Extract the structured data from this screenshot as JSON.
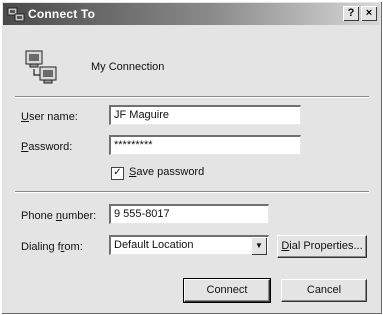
{
  "window": {
    "title": "Connect To",
    "help_button": "?",
    "close_button": "×"
  },
  "connection": {
    "name": "My Connection"
  },
  "form": {
    "username_label": "User name:",
    "username_value": "JF Maguire",
    "password_label": "Password:",
    "password_value": "*********",
    "save_password_label": "Save password",
    "save_password_checked": true,
    "save_password_mark": "✓",
    "phone_label": "Phone number:",
    "phone_value": "9 555-8017",
    "dialing_label": "Dialing from:",
    "dialing_value": "Default Location",
    "dropdown_arrow": "▼",
    "dial_properties_label": "Dial Properties..."
  },
  "buttons": {
    "connect_label": "Connect",
    "cancel_label": "Cancel"
  }
}
